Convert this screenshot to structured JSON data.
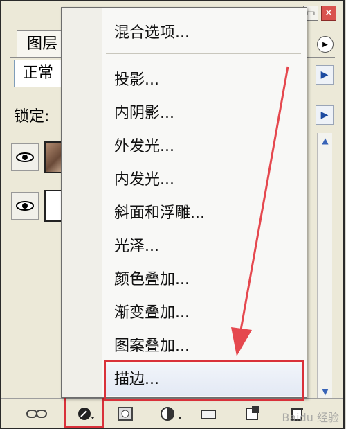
{
  "panel": {
    "tab_label": "图层",
    "blend_mode": "正常",
    "lock_label": "锁定:"
  },
  "menu": {
    "items": [
      "混合选项...",
      "投影...",
      "内阴影...",
      "外发光...",
      "内发光...",
      "斜面和浮雕...",
      "光泽...",
      "颜色叠加...",
      "渐变叠加...",
      "图案叠加...",
      "描边..."
    ]
  },
  "icons": {
    "minimize": "minimize-icon",
    "close": "close-icon",
    "panel_menu": "panel-menu-icon",
    "link": "link-layers-icon",
    "fx": "layer-style-icon",
    "mask": "add-mask-icon",
    "adjustment": "adjustment-layer-icon",
    "group": "new-group-icon",
    "new_layer": "new-layer-icon",
    "delete": "delete-layer-icon"
  },
  "colors": {
    "highlight_red": "#d9313a",
    "annotation_arrow": "#e5484e"
  },
  "watermark": "Baidu 经验"
}
